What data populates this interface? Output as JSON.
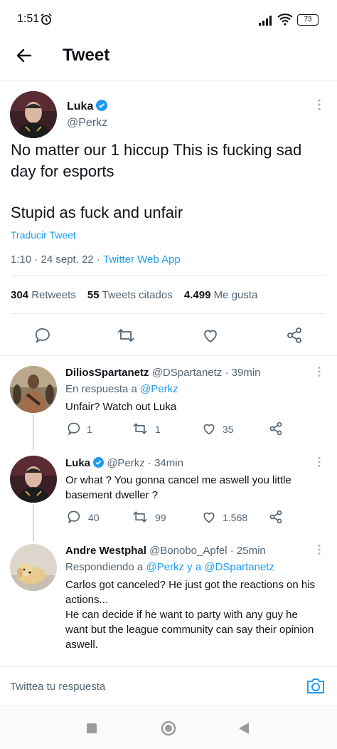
{
  "status_bar": {
    "time": "1:51",
    "battery": "73",
    "icons": [
      "alarm-icon",
      "signal-icon",
      "wifi-icon",
      "battery-icon"
    ]
  },
  "header": {
    "title": "Tweet"
  },
  "tweet": {
    "author_name": "Luka",
    "author_handle": "@Perkz",
    "text_line1": "No matter our 1 hiccup This is fucking sad",
    "text_line2": "day for esports",
    "text_line3": "Stupid as fuck and unfair",
    "translate": "Traducir Tweet",
    "time": "1:10 · 24 sept. 22 · ",
    "app": "Twitter Web App",
    "retweets_count": "304",
    "retweets_label": "Retweets",
    "quotes_count": "55",
    "quotes_label": "Tweets citados",
    "likes_count": "4.499",
    "likes_label": "Me gusta"
  },
  "replies": [
    {
      "name": "DiliosSpartanetz",
      "handle": "@DSpartanetz · 39min",
      "reply_to_prefix": "En respuesta a ",
      "reply_to": "@Perkz",
      "text": "Unfair? Watch out Luka",
      "replies": "1",
      "retweets": "1",
      "likes": "35"
    },
    {
      "name": "Luka",
      "handle": "@Perkz · 34min",
      "text_line1": "Or what ? You gonna cancel me aswell you little",
      "text_line2": "basement dweller ?",
      "replies": "40",
      "retweets": "99",
      "likes": "1.568"
    },
    {
      "name": "Andre Westphal",
      "handle": "@Bonobo_Apfel · 25min",
      "reply_to_prefix": "Respondiendo a ",
      "reply_to": "@Perkz y a @DSpartanetz",
      "text_line1": "Carlos got canceled? He just got the reactions on his",
      "text_line2": "actions...",
      "text_line3": "He can decide if he want to party with any guy he",
      "text_line4": "want but the league community can say their opinion",
      "text_line5": "aswell."
    }
  ],
  "compose": {
    "placeholder": "Twittea tu respuesta"
  },
  "colors": {
    "accent": "#1d9bf0",
    "text": "#0f1419",
    "secondary": "#536471"
  }
}
